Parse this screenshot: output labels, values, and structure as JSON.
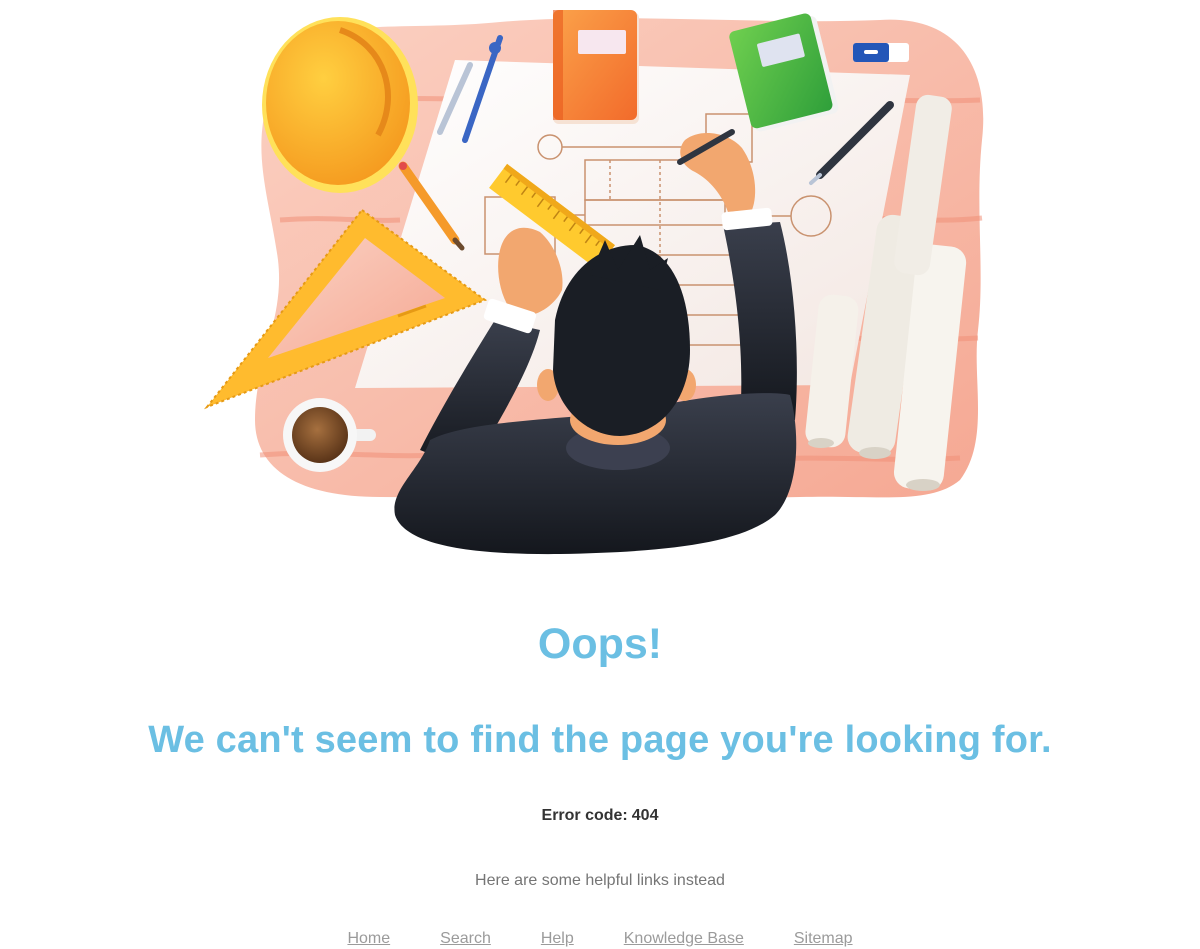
{
  "hero": {
    "illustration": "architect-drafting-at-desk-illustration"
  },
  "heading": {
    "oops": "Oops!",
    "message": "We can't seem to find the page you're looking for."
  },
  "error": {
    "label": "Error code:",
    "code": "404"
  },
  "helper_text": "Here are some helpful links instead",
  "links": {
    "home": "Home",
    "search": "Search",
    "help": "Help",
    "knowledge_base": "Knowledge Base",
    "sitemap": "Sitemap"
  },
  "colors": {
    "heading": "#6bbfe3",
    "error_text": "#333333",
    "helper_text": "#757575",
    "link": "#9b9b9b",
    "desk": "#f7b7a3"
  }
}
